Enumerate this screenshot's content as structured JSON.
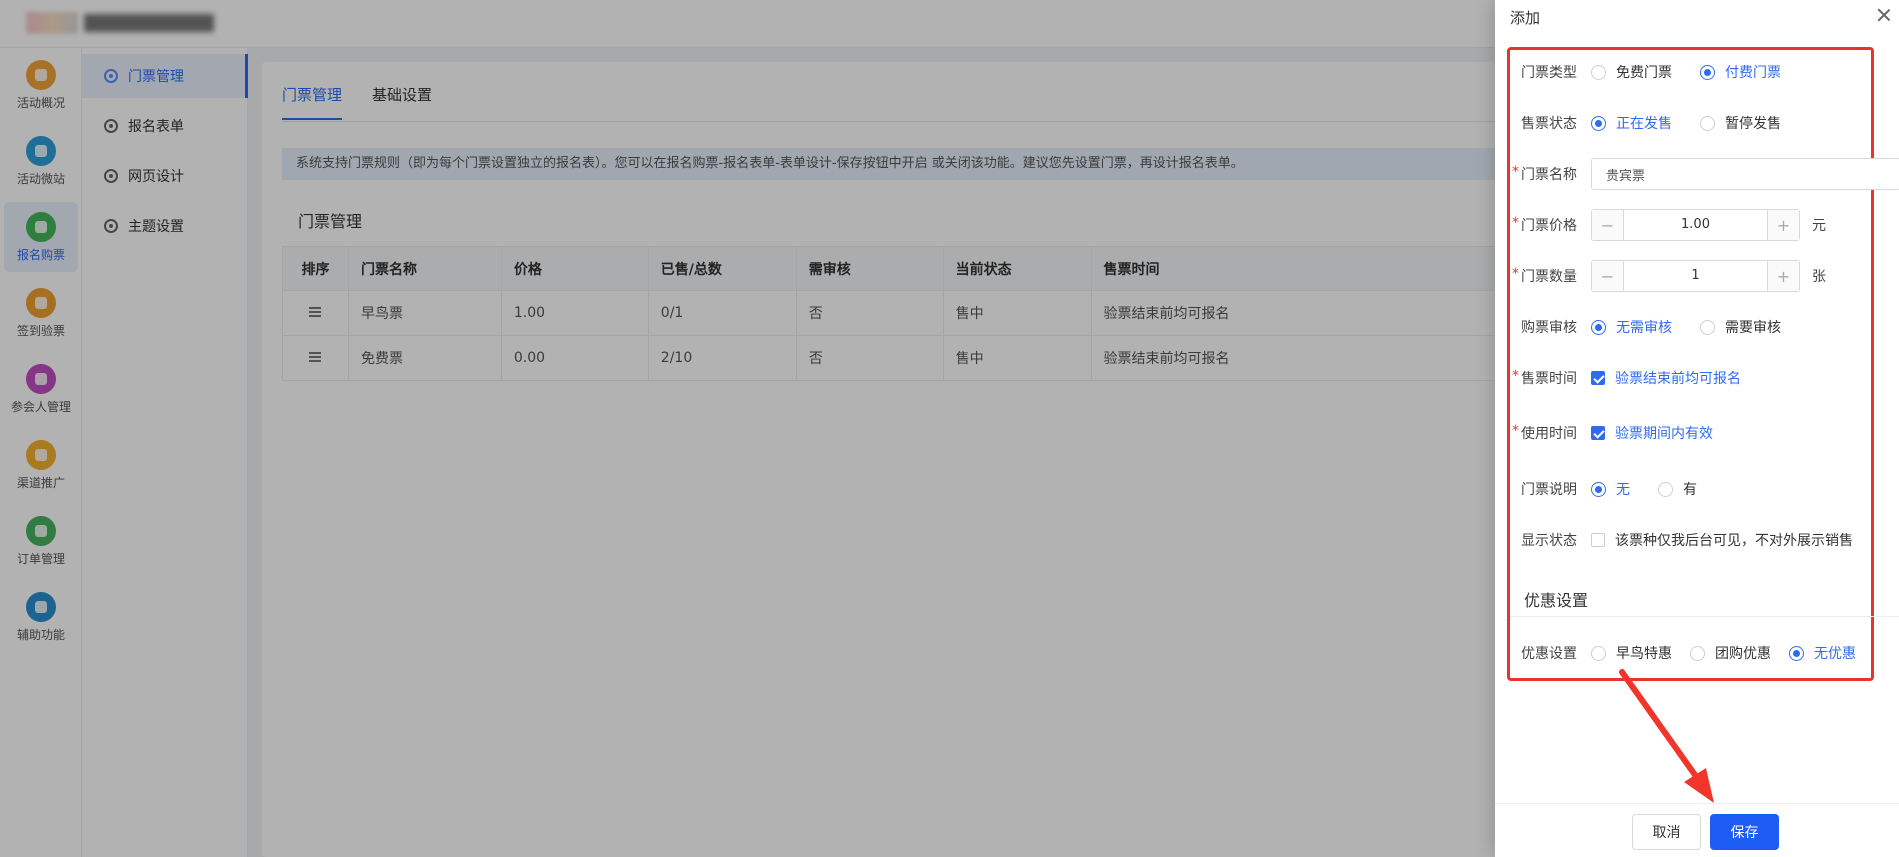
{
  "rail": {
    "items": [
      {
        "label": "活动概况",
        "color": "#f2a23a"
      },
      {
        "label": "活动微站",
        "color": "#2a9fd8"
      },
      {
        "label": "报名购票",
        "color": "#42b65a"
      },
      {
        "label": "签到验票",
        "color": "#f0a030"
      },
      {
        "label": "参会人管理",
        "color": "#c04ec0"
      },
      {
        "label": "渠道推广",
        "color": "#f2b030"
      },
      {
        "label": "订单管理",
        "color": "#48b060"
      },
      {
        "label": "辅助功能",
        "color": "#2a8fd0"
      }
    ]
  },
  "subnav": {
    "items": [
      "门票管理",
      "报名表单",
      "网页设计",
      "主题设置"
    ]
  },
  "main": {
    "tabs": [
      "门票管理",
      "基础设置"
    ],
    "notice": "系统支持门票规则（即为每个门票设置独立的报名表）。您可以在报名购票-报名表单-表单设计-保存按钮中开启 或关闭该功能。建议您先设置门票，再设计报名表单。",
    "section_title": "门票管理",
    "table": {
      "headers": [
        "排序",
        "门票名称",
        "价格",
        "已售/总数",
        "需审核",
        "当前状态",
        "售票时间"
      ],
      "rows": [
        [
          "早鸟票",
          "1.00",
          "0/1",
          "否",
          "售中",
          "验票结束前均可报名"
        ],
        [
          "免费票",
          "0.00",
          "2/10",
          "否",
          "售中",
          "验票结束前均可报名"
        ]
      ]
    }
  },
  "drawer": {
    "title": "添加",
    "fields": {
      "ticket_type": {
        "label": "门票类型",
        "options": [
          "免费门票",
          "付费门票"
        ]
      },
      "sale_status": {
        "label": "售票状态",
        "options": [
          "正在发售",
          "暂停发售"
        ]
      },
      "ticket_name": {
        "label": "门票名称",
        "value": "贵宾票"
      },
      "ticket_price": {
        "label": "门票价格",
        "value": "1.00",
        "unit": "元"
      },
      "ticket_qty": {
        "label": "门票数量",
        "value": "1",
        "unit": "张"
      },
      "review": {
        "label": "购票审核",
        "options": [
          "无需审核",
          "需要审核"
        ]
      },
      "sale_time": {
        "label": "售票时间",
        "option": "验票结束前均可报名"
      },
      "use_time": {
        "label": "使用时间",
        "option": "验票期间内有效"
      },
      "description": {
        "label": "门票说明",
        "options": [
          "无",
          "有"
        ]
      },
      "display": {
        "label": "显示状态",
        "option": "该票种仅我后台可见，不对外展示销售"
      }
    },
    "discount_section": "优惠设置",
    "discount": {
      "label": "优惠设置",
      "options": [
        "早鸟特惠",
        "团购优惠",
        "无优惠"
      ]
    },
    "cancel": "取消",
    "save": "保存"
  },
  "colors": {
    "accent": "#2f6bf2",
    "highlight": "#e8352b",
    "save": "#1d5cf5"
  },
  "icons": {
    "minus": "−",
    "plus": "+"
  }
}
